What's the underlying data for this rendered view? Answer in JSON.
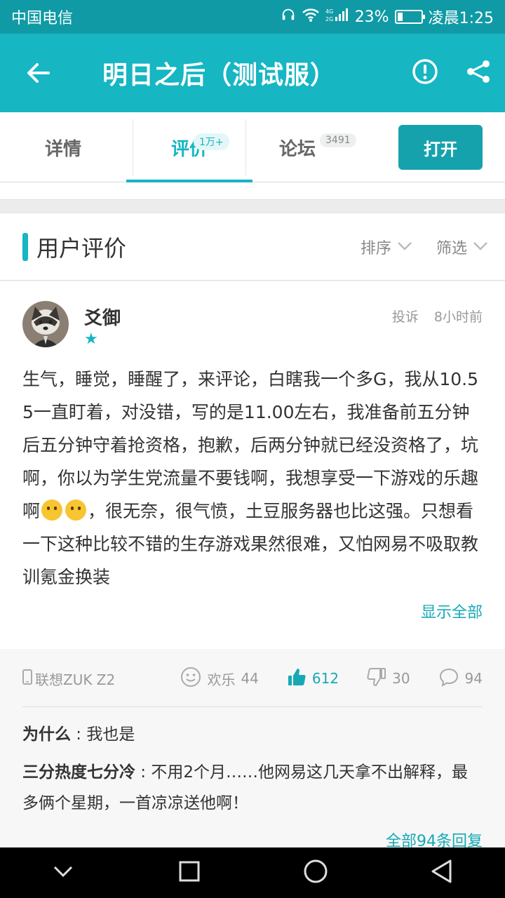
{
  "status_bar": {
    "carrier": "中国电信",
    "signal": "4G 2G",
    "battery_percent": "23%",
    "battery_level": 0.23,
    "time": "凌晨1:25"
  },
  "app_bar": {
    "back_icon": "back-arrow-icon",
    "title": "明日之后（测试服）",
    "report_icon": "exclamation-circle-icon",
    "share_icon": "share-icon"
  },
  "tabs": [
    {
      "label": "详情",
      "badge": ""
    },
    {
      "label": "评价",
      "badge": "1万+"
    },
    {
      "label": "论坛",
      "badge": "3491"
    }
  ],
  "open_button": "打开",
  "section": {
    "title": "用户评价",
    "sort": "排序",
    "filter": "筛选"
  },
  "review": {
    "username": "爻御",
    "star": "★",
    "report": "投诉",
    "time": "8小时前",
    "content_a": "生气，睡觉，睡醒了，来评论，白瞎我一个多G，我从10.55一直盯着，对没错，写的是11.00左右，我准备前五分钟后五分钟守着抢资格，抱歉，后两分钟就已经没资格了，坑啊，你以为学生党流量不要钱啊，我想享受一下游戏的乐趣啊",
    "content_b": "，很无奈，很气愤，土豆服务器也比这强。只想看一下这种比较不错的生存游戏果然很难，又怕网易不吸取教训氪金换装",
    "show_all": "显示全部",
    "device": "联想ZUK Z2",
    "happy_label": "欢乐",
    "happy_count": "44",
    "like_count": "612",
    "dislike_count": "30",
    "comment_count": "94"
  },
  "replies": [
    {
      "user": "为什么",
      "sep": " : ",
      "text": "我也是"
    },
    {
      "user": "三分热度七分冷",
      "sep": " : ",
      "text": "不用2个月……他网易这几天拿不出解释，最多俩个星期，一首凉凉送他啊！"
    }
  ],
  "all_replies": "全部94条回复",
  "colors": {
    "accent": "#16b6c2",
    "status_bar": "#0f9aa5",
    "link": "#16a9b5"
  }
}
